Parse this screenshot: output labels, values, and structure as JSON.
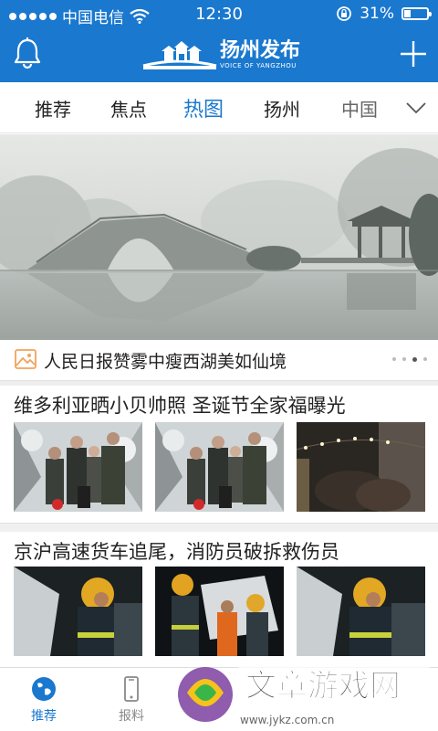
{
  "status_bar": {
    "carrier": "中国电信",
    "time": "12:30",
    "battery": "31%",
    "battery_level": 0.31
  },
  "header": {
    "logo_cn": "扬州发布",
    "logo_en": "VOICE OF YANGZHOU",
    "left_icon": "bell-icon",
    "right_icon": "plus-icon"
  },
  "tabs": {
    "items": [
      "推荐",
      "焦点",
      "热图",
      "扬州",
      "中国"
    ],
    "active_index": 2,
    "more_icon": "chevron-down-icon"
  },
  "banner": {
    "caption": "人民日报赞雾中瘦西湖美如仙境",
    "caption_icon": "image-icon",
    "page_count": 3,
    "active_page": 2
  },
  "news": [
    {
      "title": "维多利亚晒小贝帅照 圣诞节全家福曝光"
    },
    {
      "title": "京沪高速货车追尾，消防员破拆救伤员"
    }
  ],
  "bottom_nav": {
    "items": [
      {
        "label": "推荐",
        "icon": "globe-icon"
      },
      {
        "label": "报料",
        "icon": "phone-icon"
      }
    ],
    "active_index": 0
  },
  "watermark": {
    "text": "文章游戏网",
    "url": "www.jykz.com.cn"
  },
  "colors": {
    "brand": "#1a78cf",
    "caption_icon": "#f0a45a"
  }
}
